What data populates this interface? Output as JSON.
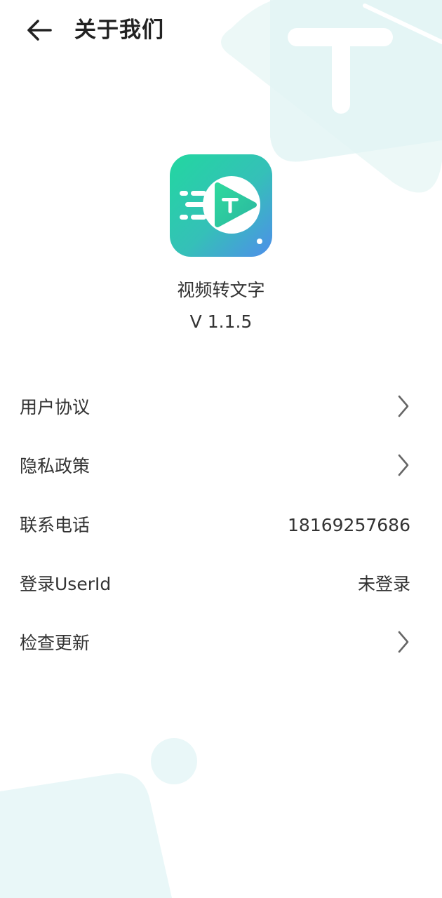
{
  "header": {
    "back_icon": "arrow-left-icon",
    "title": "关于我们"
  },
  "app": {
    "icon": "app-logo-icon",
    "icon_letter": "T",
    "name": "视频转文字",
    "version": "V 1.1.5"
  },
  "menu": {
    "items": [
      {
        "label": "用户协议",
        "value": "",
        "chevron": true
      },
      {
        "label": "隐私政策",
        "value": "",
        "chevron": true
      },
      {
        "label": "联系电话",
        "value": "18169257686",
        "chevron": false
      },
      {
        "label": "登录UserId",
        "value": "未登录",
        "chevron": false
      },
      {
        "label": "检查更新",
        "value": "",
        "chevron": true
      }
    ]
  },
  "colors": {
    "accent_green": "#2fd39a",
    "accent_blue": "#4a8ce8",
    "decor_light": "#e9f7f7",
    "text_primary": "#333333"
  },
  "background": {
    "decor_letter": "T"
  }
}
